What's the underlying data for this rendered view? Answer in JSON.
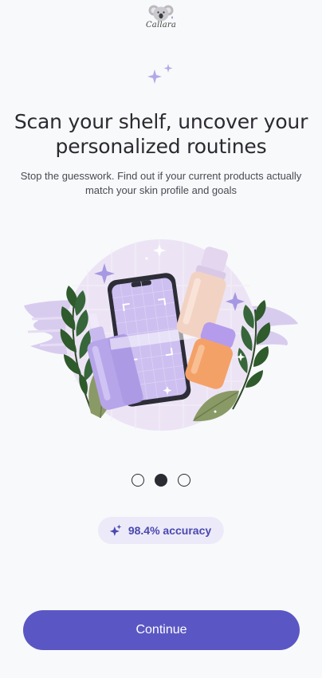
{
  "brand": {
    "name": "Callara",
    "icon": "koala-icon"
  },
  "onboarding": {
    "title": "Scan your shelf, uncover your personalized routines",
    "subtitle": "Stop the guesswork. Find out if your current products actually match your skin profile and goals",
    "illustration": "phone-scanning-skincare-products-illustration",
    "pages": {
      "total": 3,
      "current": 2
    }
  },
  "badge": {
    "icon": "sparkle-icon",
    "text": "98.4% accuracy"
  },
  "cta": {
    "label": "Continue"
  },
  "colors": {
    "accent": "#5a57c4",
    "badge_bg": "#eceaf8",
    "badge_text": "#4a48b0",
    "background": "#f8f9fb",
    "illustration_circle": "#ece4f4"
  }
}
